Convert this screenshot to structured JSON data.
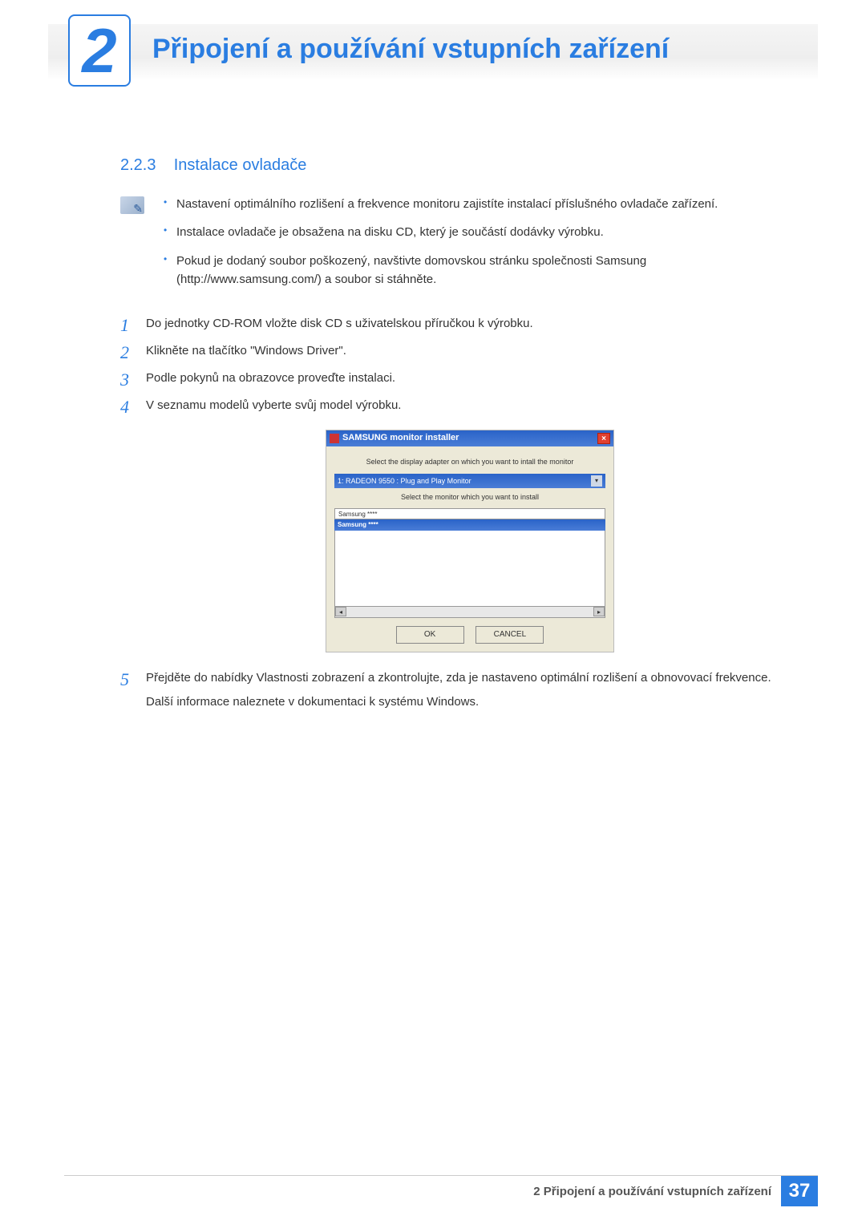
{
  "chapter": {
    "number": "2",
    "title": "Připojení a používání vstupních zařízení"
  },
  "section": {
    "number": "2.2.3",
    "title": "Instalace ovladače"
  },
  "notes": [
    "Nastavení optimálního rozlišení a frekvence monitoru zajistíte instalací příslušného ovladače zařízení.",
    "Instalace ovladače je obsažena na disku CD, který je součástí dodávky výrobku.",
    "Pokud je dodaný soubor poškozený, navštivte domovskou stránku společnosti Samsung (http://www.samsung.com/) a soubor si stáhněte."
  ],
  "steps": [
    {
      "n": "1",
      "text": "Do jednotky CD-ROM vložte disk CD s uživatelskou příručkou k výrobku."
    },
    {
      "n": "2",
      "text": "Klikněte na tlačítko \"Windows Driver\"."
    },
    {
      "n": "3",
      "text": "Podle pokynů na obrazovce proveďte instalaci."
    },
    {
      "n": "4",
      "text": "V seznamu modelů vyberte svůj model výrobku."
    },
    {
      "n": "5",
      "text": "Přejděte do nabídky Vlastnosti zobrazení a zkontrolujte, zda je nastaveno optimální rozlišení a obnovovací frekvence.",
      "extra": "Další informace naleznete v dokumentaci k systému Windows."
    }
  ],
  "installer": {
    "title": "SAMSUNG monitor installer",
    "prompt1": "Select the display adapter on which you want to intall the monitor",
    "dropdown": "1: RADEON 9550 : Plug and Play Monitor",
    "prompt2": "Select the monitor which you want to install",
    "list_header": "Samsung ****",
    "list_selected": "Samsung ****",
    "ok": "OK",
    "cancel": "CANCEL"
  },
  "footer": {
    "text": "2 Připojení a používání vstupních zařízení",
    "page": "37"
  }
}
